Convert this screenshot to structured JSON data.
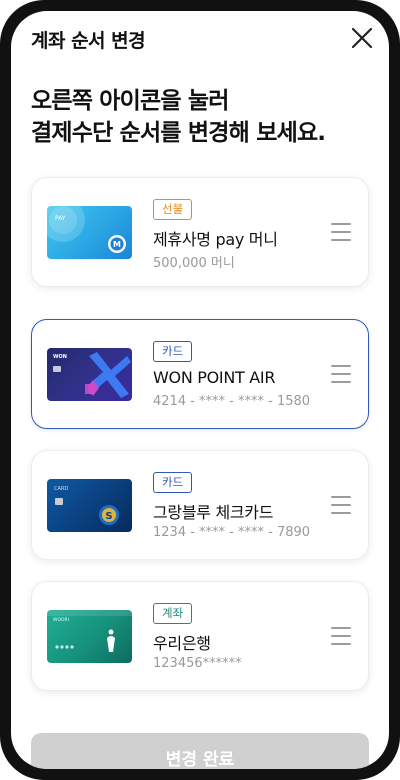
{
  "header": {
    "title": "계좌 순서 변경",
    "close_icon": "close-icon"
  },
  "headline": {
    "line1": "오른쪽 아이콘을 눌러",
    "line2": "결제수단 순서를 변경해 보세요."
  },
  "items": [
    {
      "badge": "선불",
      "badge_color": "#e58a1f",
      "name": "제휴사명 pay 머니",
      "sub": "500,000 머니",
      "card_colors": [
        "#3ec5ea",
        "#1a8fd8"
      ],
      "card_text": "PAY"
    },
    {
      "badge": "카드",
      "badge_color": "#2f58b8",
      "name": "WON POINT AIR",
      "sub": "4214 - **** - **** - 1580",
      "card_colors": [
        "#2b2f7e",
        "#4a3bb0"
      ],
      "card_text": "WON",
      "selected": true
    },
    {
      "badge": "카드",
      "badge_color": "#2f58b8",
      "name": "그랑블루 체크카드",
      "sub": "1234 - **** - **** - 7890",
      "card_colors": [
        "#0e4f96",
        "#062a5c"
      ],
      "card_text": "CARD"
    },
    {
      "badge": "계좌",
      "badge_color": "#1e8c7a",
      "name": "우리은행",
      "sub": "123456******",
      "card_colors": [
        "#1aa08a",
        "#0e6b5f"
      ],
      "card_text": "WOORI"
    }
  ],
  "footer": {
    "button_label": "변경 완료"
  }
}
